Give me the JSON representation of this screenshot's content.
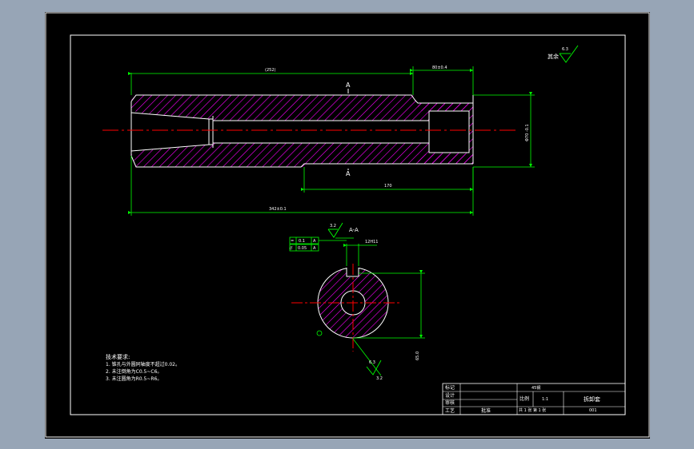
{
  "colors": {
    "background_app": "#97a5b6",
    "canvas": "#000000",
    "frame": "#ffffff",
    "outline": "#ffffff",
    "dimension": "#00ff00",
    "hatch": "#ff00ff",
    "centerline": "#ff0000"
  },
  "drawing": {
    "dims": {
      "d_252": "(252)",
      "d_80": "80±0.4",
      "d_dia": "Φ70 -0.1",
      "d_170": "170",
      "d_342": "342±0.1",
      "d_12h11": "12H11",
      "d_65": "65.0"
    },
    "section_labels": {
      "cut_top": "A",
      "cut_bottom": "A",
      "section_view": "A-A"
    },
    "roughness": {
      "rest": "其余",
      "rest_value": "6.3",
      "keyway_value": "3.2",
      "bore_value": "6.3",
      "bore_value2": "3.2"
    },
    "tolerance_frames": [
      {
        "symbol": "=",
        "value": "0.1",
        "datum": "A"
      },
      {
        "symbol": "//",
        "value": "0.05",
        "datum": "A"
      }
    ],
    "notes": {
      "title": "技术要求:",
      "line1": "1. 锥孔与外圆同轴度不超过0.02。",
      "line2": "2. 未注倒角为C0.5~C6。",
      "line3": "3. 未注圆角为R0.5~R6。"
    },
    "title_block": {
      "row1": "标记",
      "row2": "设计",
      "row3": "审核",
      "row4": "工艺",
      "material": "45钢",
      "scale_label": "比例",
      "scale": "1:1",
      "name": "拆卸套",
      "sheet": "共 1 张 第 1 张",
      "code": "001",
      "approve": "批准"
    }
  }
}
